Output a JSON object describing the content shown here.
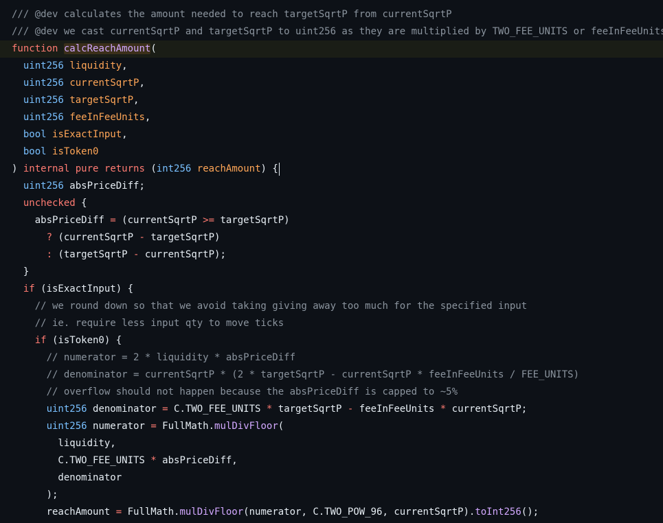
{
  "editor": {
    "language": "solidity",
    "current_line": 2,
    "caret_line": 9,
    "lines": [
      [
        {
          "t": "/// @dev calculates the amount needed to reach targetSqrtP from currentSqrtP",
          "c": "comment"
        }
      ],
      [
        {
          "t": "/// @dev we cast currentSqrtP and targetSqrtP to uint256 as they are multiplied by TWO_FEE_UNITS or feeInFeeUnits",
          "c": "comment"
        }
      ],
      [
        {
          "t": "function",
          "c": "keyword"
        },
        {
          "t": " ",
          "c": "plain"
        },
        {
          "t": "calcReachAmount",
          "c": "hl"
        },
        {
          "t": "(",
          "c": "plain"
        }
      ],
      [
        {
          "t": "  ",
          "c": "plain"
        },
        {
          "t": "uint256",
          "c": "type"
        },
        {
          "t": " ",
          "c": "plain"
        },
        {
          "t": "liquidity",
          "c": "param"
        },
        {
          "t": ",",
          "c": "plain"
        }
      ],
      [
        {
          "t": "  ",
          "c": "plain"
        },
        {
          "t": "uint256",
          "c": "type"
        },
        {
          "t": " ",
          "c": "plain"
        },
        {
          "t": "currentSqrtP",
          "c": "param"
        },
        {
          "t": ",",
          "c": "plain"
        }
      ],
      [
        {
          "t": "  ",
          "c": "plain"
        },
        {
          "t": "uint256",
          "c": "type"
        },
        {
          "t": " ",
          "c": "plain"
        },
        {
          "t": "targetSqrtP",
          "c": "param"
        },
        {
          "t": ",",
          "c": "plain"
        }
      ],
      [
        {
          "t": "  ",
          "c": "plain"
        },
        {
          "t": "uint256",
          "c": "type"
        },
        {
          "t": " ",
          "c": "plain"
        },
        {
          "t": "feeInFeeUnits",
          "c": "param"
        },
        {
          "t": ",",
          "c": "plain"
        }
      ],
      [
        {
          "t": "  ",
          "c": "plain"
        },
        {
          "t": "bool",
          "c": "type"
        },
        {
          "t": " ",
          "c": "plain"
        },
        {
          "t": "isExactInput",
          "c": "param"
        },
        {
          "t": ",",
          "c": "plain"
        }
      ],
      [
        {
          "t": "  ",
          "c": "plain"
        },
        {
          "t": "bool",
          "c": "type"
        },
        {
          "t": " ",
          "c": "plain"
        },
        {
          "t": "isToken0",
          "c": "param"
        }
      ],
      [
        {
          "t": ") ",
          "c": "plain"
        },
        {
          "t": "internal",
          "c": "keyword"
        },
        {
          "t": " ",
          "c": "plain"
        },
        {
          "t": "pure",
          "c": "keyword"
        },
        {
          "t": " ",
          "c": "plain"
        },
        {
          "t": "returns",
          "c": "keyword"
        },
        {
          "t": " (",
          "c": "plain"
        },
        {
          "t": "int256",
          "c": "type"
        },
        {
          "t": " ",
          "c": "plain"
        },
        {
          "t": "reachAmount",
          "c": "param"
        },
        {
          "t": ") {",
          "c": "plain"
        }
      ],
      [
        {
          "t": "  ",
          "c": "plain"
        },
        {
          "t": "uint256",
          "c": "type"
        },
        {
          "t": " absPriceDiff;",
          "c": "plain"
        }
      ],
      [
        {
          "t": "  ",
          "c": "plain"
        },
        {
          "t": "unchecked",
          "c": "keyword"
        },
        {
          "t": " {",
          "c": "plain"
        }
      ],
      [
        {
          "t": "    absPriceDiff ",
          "c": "plain"
        },
        {
          "t": "=",
          "c": "op"
        },
        {
          "t": " (currentSqrtP ",
          "c": "plain"
        },
        {
          "t": ">=",
          "c": "op"
        },
        {
          "t": " targetSqrtP)",
          "c": "plain"
        }
      ],
      [
        {
          "t": "      ",
          "c": "plain"
        },
        {
          "t": "?",
          "c": "op"
        },
        {
          "t": " (currentSqrtP ",
          "c": "plain"
        },
        {
          "t": "-",
          "c": "op"
        },
        {
          "t": " targetSqrtP)",
          "c": "plain"
        }
      ],
      [
        {
          "t": "      ",
          "c": "plain"
        },
        {
          "t": ":",
          "c": "op"
        },
        {
          "t": " (targetSqrtP ",
          "c": "plain"
        },
        {
          "t": "-",
          "c": "op"
        },
        {
          "t": " currentSqrtP);",
          "c": "plain"
        }
      ],
      [
        {
          "t": "  }",
          "c": "plain"
        }
      ],
      [
        {
          "t": "  ",
          "c": "plain"
        },
        {
          "t": "if",
          "c": "keyword"
        },
        {
          "t": " (isExactInput) {",
          "c": "plain"
        }
      ],
      [
        {
          "t": "    // we round down so that we avoid taking giving away too much for the specified input",
          "c": "comment"
        }
      ],
      [
        {
          "t": "    // ie. require less input qty to move ticks",
          "c": "comment"
        }
      ],
      [
        {
          "t": "    ",
          "c": "plain"
        },
        {
          "t": "if",
          "c": "keyword"
        },
        {
          "t": " (isToken0) {",
          "c": "plain"
        }
      ],
      [
        {
          "t": "      // numerator = 2 * liquidity * absPriceDiff",
          "c": "comment"
        }
      ],
      [
        {
          "t": "      // denominator = currentSqrtP * (2 * targetSqrtP - currentSqrtP * feeInFeeUnits / FEE_UNITS)",
          "c": "comment"
        }
      ],
      [
        {
          "t": "      // overflow should not happen because the absPriceDiff is capped to ~5%",
          "c": "comment"
        }
      ],
      [
        {
          "t": "      ",
          "c": "plain"
        },
        {
          "t": "uint256",
          "c": "type"
        },
        {
          "t": " denominator ",
          "c": "plain"
        },
        {
          "t": "=",
          "c": "op"
        },
        {
          "t": " C.TWO_FEE_UNITS ",
          "c": "plain"
        },
        {
          "t": "*",
          "c": "op"
        },
        {
          "t": " targetSqrtP ",
          "c": "plain"
        },
        {
          "t": "-",
          "c": "op"
        },
        {
          "t": " feeInFeeUnits ",
          "c": "plain"
        },
        {
          "t": "*",
          "c": "op"
        },
        {
          "t": " currentSqrtP;",
          "c": "plain"
        }
      ],
      [
        {
          "t": "      ",
          "c": "plain"
        },
        {
          "t": "uint256",
          "c": "type"
        },
        {
          "t": " numerator ",
          "c": "plain"
        },
        {
          "t": "=",
          "c": "op"
        },
        {
          "t": " FullMath.",
          "c": "plain"
        },
        {
          "t": "mulDivFloor",
          "c": "func"
        },
        {
          "t": "(",
          "c": "plain"
        }
      ],
      [
        {
          "t": "        liquidity,",
          "c": "plain"
        }
      ],
      [
        {
          "t": "        C.TWO_FEE_UNITS ",
          "c": "plain"
        },
        {
          "t": "*",
          "c": "op"
        },
        {
          "t": " absPriceDiff,",
          "c": "plain"
        }
      ],
      [
        {
          "t": "        denominator",
          "c": "plain"
        }
      ],
      [
        {
          "t": "      );",
          "c": "plain"
        }
      ],
      [
        {
          "t": "      reachAmount ",
          "c": "plain"
        },
        {
          "t": "=",
          "c": "op"
        },
        {
          "t": " FullMath.",
          "c": "plain"
        },
        {
          "t": "mulDivFloor",
          "c": "func"
        },
        {
          "t": "(numerator, C.TWO_POW_96, currentSqrtP).",
          "c": "plain"
        },
        {
          "t": "toInt256",
          "c": "func"
        },
        {
          "t": "();",
          "c": "plain"
        }
      ]
    ]
  },
  "colors": {
    "background": "#0d1117",
    "plain": "#e6edf3",
    "comment": "#8b949e",
    "keyword": "#ff7b72",
    "type": "#79c0ff",
    "param": "#ffa657",
    "function": "#d2a8ff",
    "current_line_bg": "#1a1d16",
    "highlight_bg": "#3b2f1a"
  }
}
